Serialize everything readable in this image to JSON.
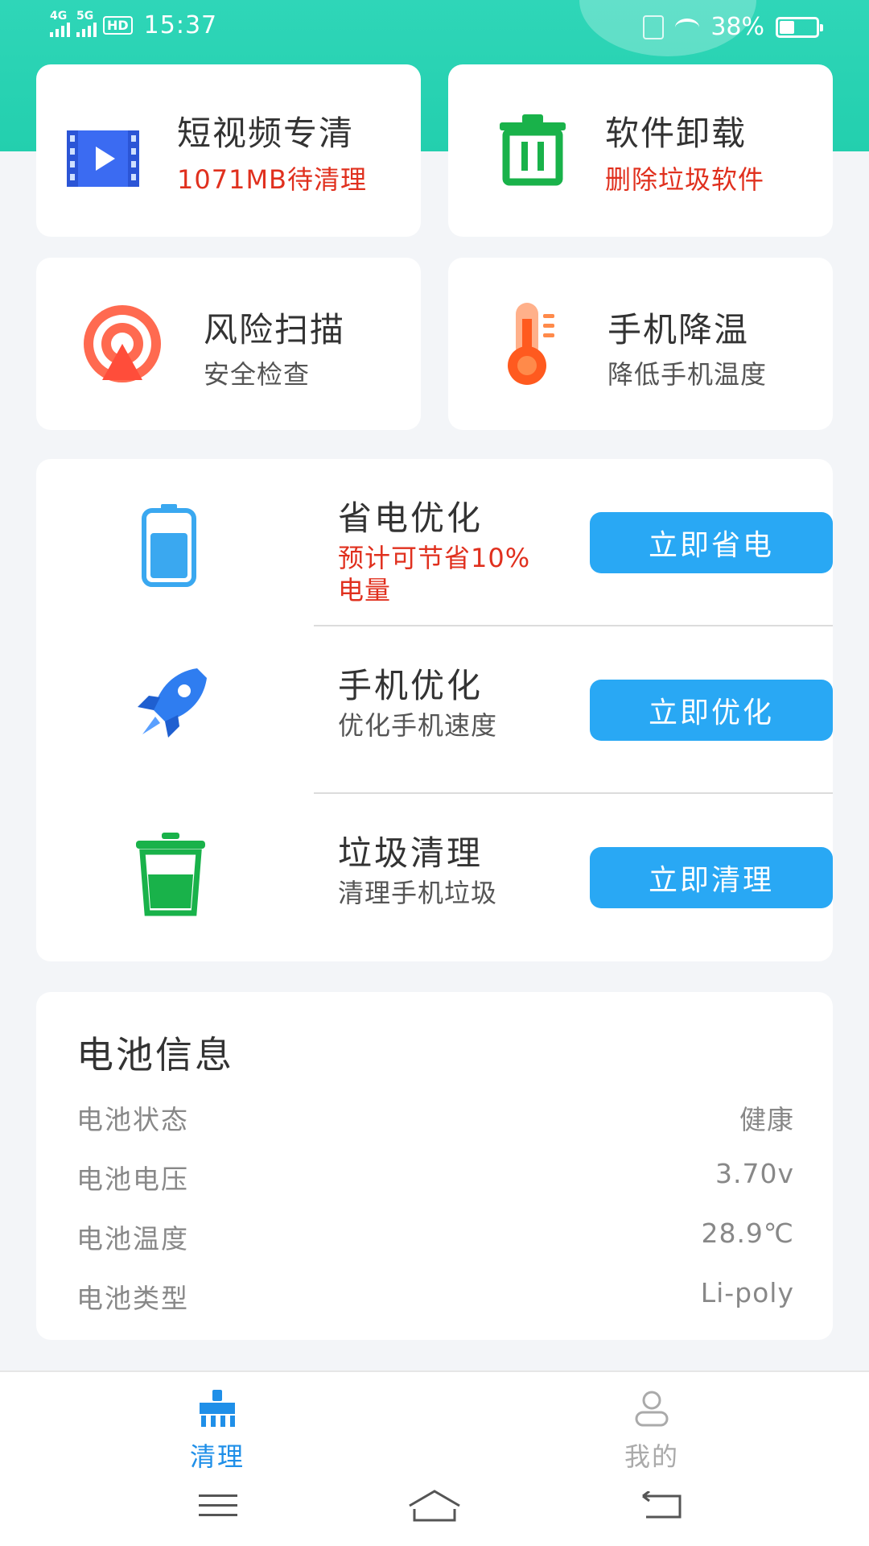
{
  "status_bar": {
    "net1": "4G",
    "net2": "5G",
    "hd": "HD",
    "time": "15:37",
    "battery_percent_text": "38%",
    "battery_level": 0.38
  },
  "tiles": {
    "video": {
      "title": "短视频专清",
      "subtitle": "1071MB待清理",
      "icon": "video-icon"
    },
    "uninstall": {
      "title": "软件卸载",
      "subtitle": "删除垃圾软件",
      "icon": "trash-icon"
    },
    "risk": {
      "title": "风险扫描",
      "subtitle": "安全检查",
      "icon": "radar-icon"
    },
    "cool": {
      "title": "手机降温",
      "subtitle": "降低手机温度",
      "icon": "thermometer-icon"
    }
  },
  "actions": {
    "power": {
      "title": "省电优化",
      "subtitle_line1": "预计可节省10%",
      "subtitle_line2": "电量",
      "button": "立即省电",
      "icon": "battery-icon"
    },
    "speed": {
      "title": "手机优化",
      "subtitle": "优化手机速度",
      "button": "立即优化",
      "icon": "rocket-icon"
    },
    "junk": {
      "title": "垃圾清理",
      "subtitle": "清理手机垃圾",
      "button": "立即清理",
      "icon": "bin-icon"
    }
  },
  "battery_info": {
    "title": "电池信息",
    "rows": [
      {
        "label": "电池状态",
        "value": "健康"
      },
      {
        "label": "电池电压",
        "value": "3.70v"
      },
      {
        "label": "电池温度",
        "value": "28.9℃"
      },
      {
        "label": "电池类型",
        "value": "Li-poly"
      }
    ]
  },
  "bottom_nav": {
    "clean": {
      "label": "清理",
      "active": true
    },
    "mine": {
      "label": "我的",
      "active": false
    }
  },
  "colors": {
    "header": "#23cfae",
    "accent_blue": "#29a8f4",
    "warning_red": "#e0301e",
    "nav_active": "#1f8fe8"
  }
}
